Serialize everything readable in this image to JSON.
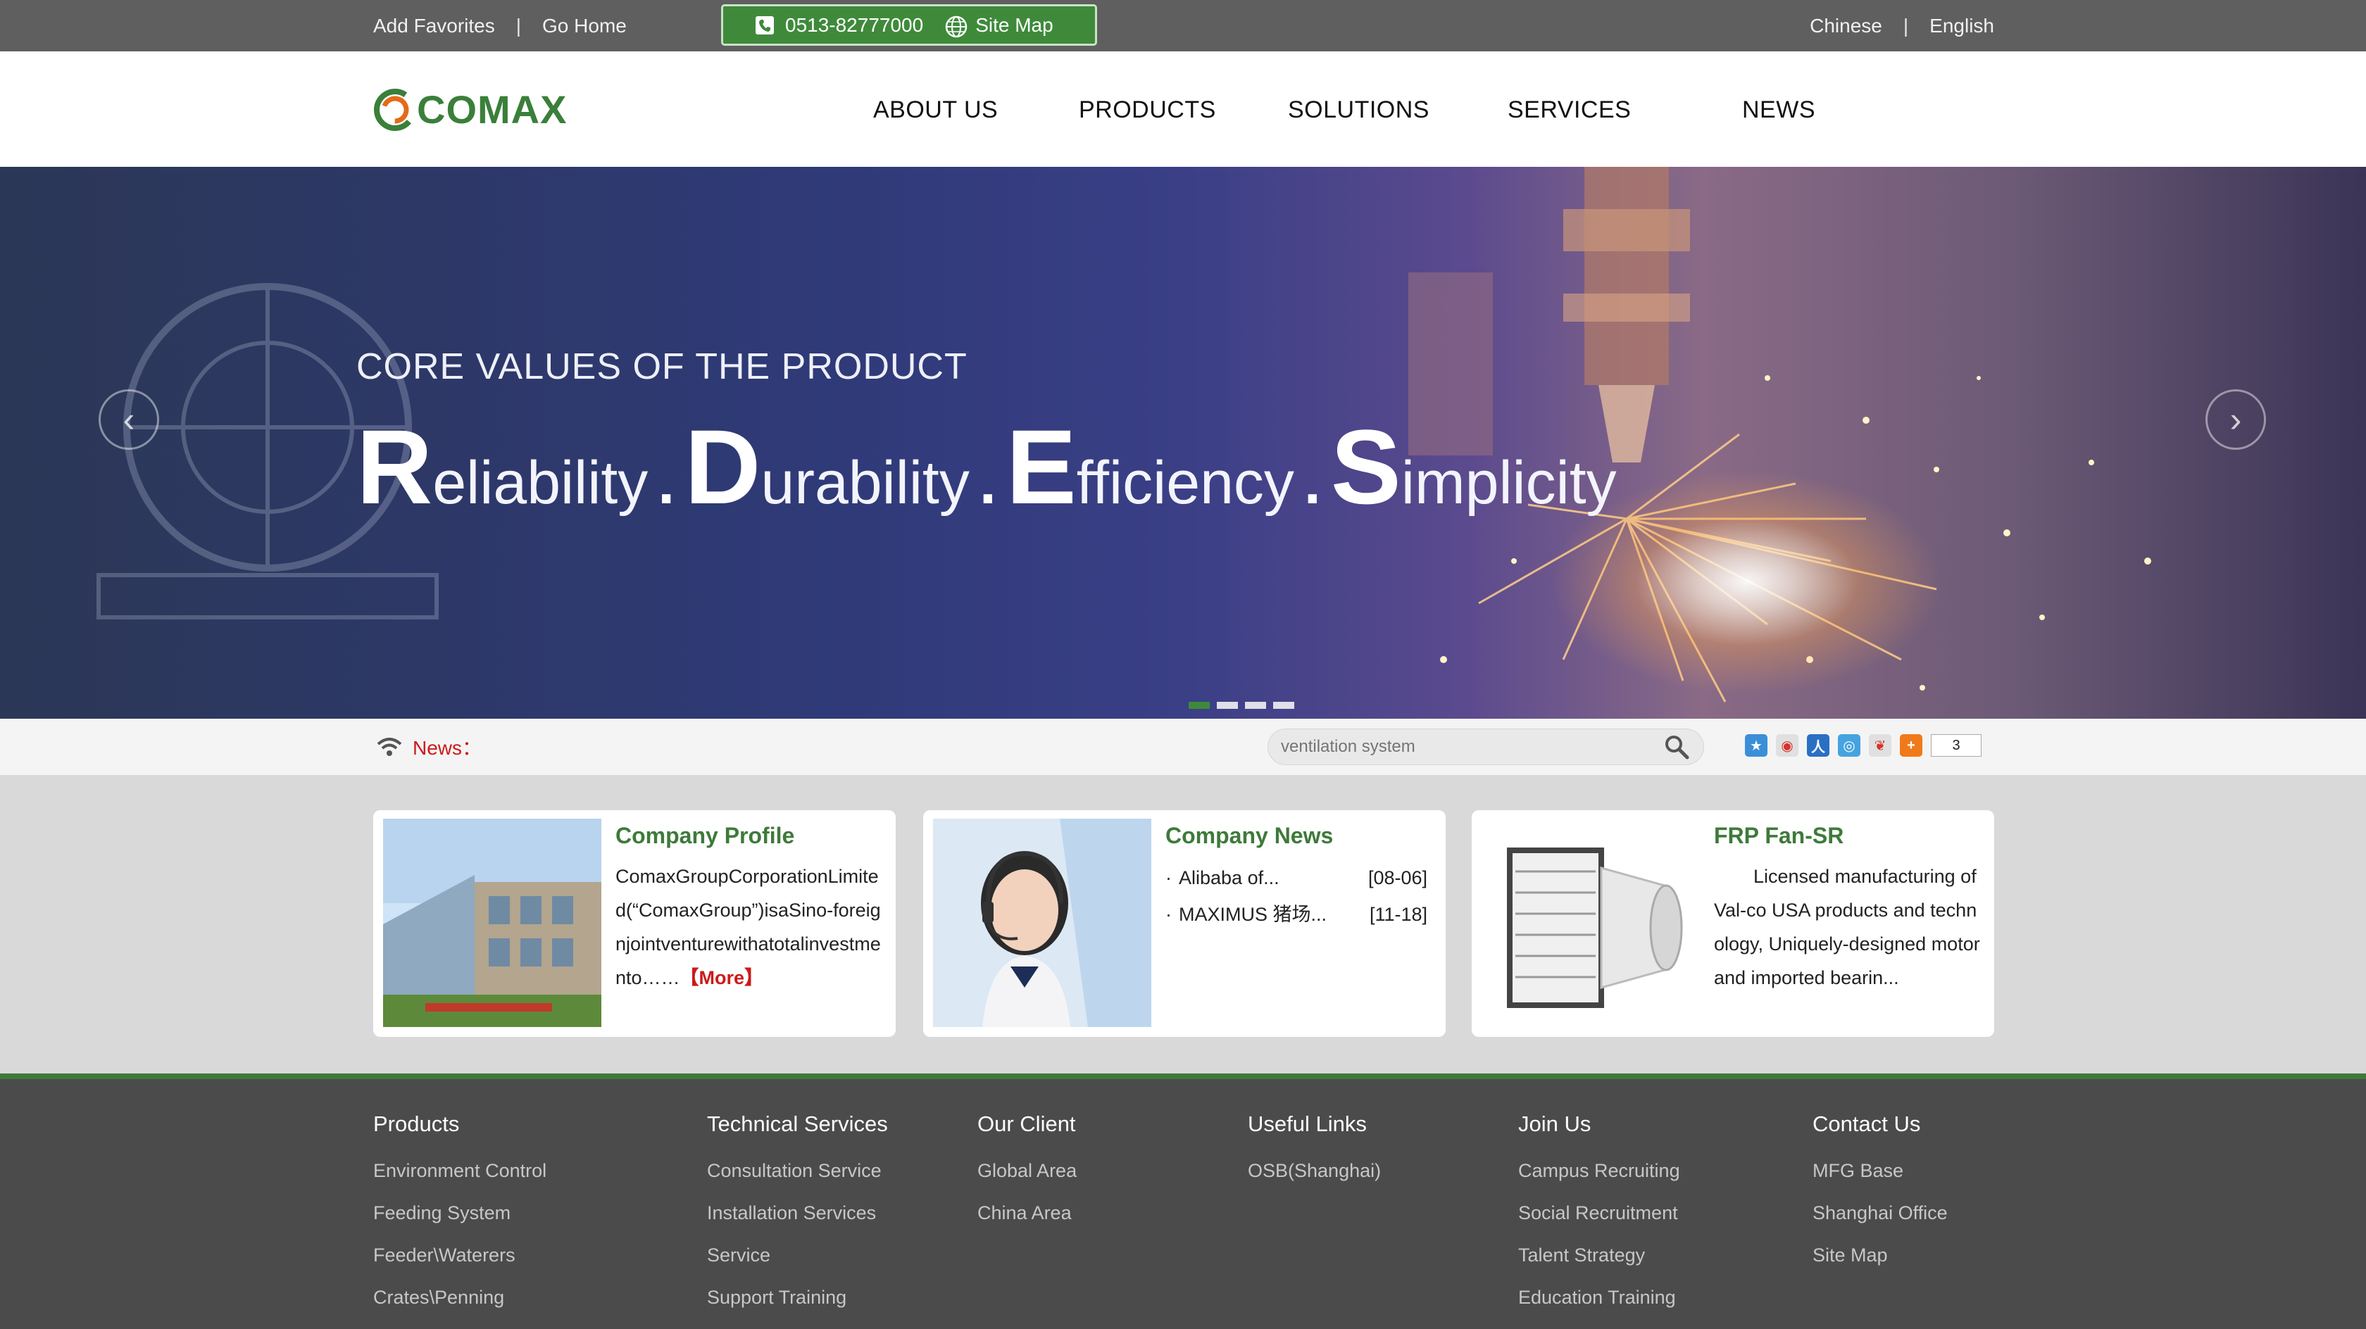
{
  "topbar": {
    "add_favorites": "Add Favorites",
    "separator": "|",
    "go_home": "Go Home",
    "phone": "0513-82777000",
    "site_map": "Site Map",
    "chinese": "Chinese",
    "english": "English"
  },
  "header": {
    "logo_text": "COMAX",
    "nav": [
      "ABOUT US",
      "PRODUCTS",
      "SOLUTIONS",
      "SERVICES",
      "NEWS"
    ]
  },
  "hero": {
    "subtitle": "CORE VALUES OF THE PRODUCT",
    "words": [
      {
        "initial": "R",
        "rest": "eliability"
      },
      {
        "initial": "D",
        "rest": "urability"
      },
      {
        "initial": "E",
        "rest": "fficiency"
      },
      {
        "initial": "S",
        "rest": "implicity"
      }
    ],
    "dot": ".",
    "prev_arrow": "‹",
    "next_arrow": "›",
    "slides_total": 4,
    "slide_active": 1
  },
  "newsbar": {
    "label": "News：",
    "search_placeholder": "ventilation system",
    "share_count": "3",
    "share_icons": [
      "qzone-icon",
      "weibo-icon",
      "renren-icon",
      "tencent-weibo-icon",
      "share-icon",
      "more-share-icon"
    ]
  },
  "cards": {
    "profile": {
      "title": "Company Profile",
      "body": "ComaxGroupCorporationLimited(“ComaxGroup”)isaSino-foreignjointventurewithatotalinvestmento……",
      "more": "【More】"
    },
    "news": {
      "title": "Company News",
      "items": [
        {
          "text": "Alibaba of...",
          "date": "[08-06]"
        },
        {
          "text": "MAXIMUS 猪场...",
          "date": "[11-18]"
        }
      ],
      "bullet": "·"
    },
    "product": {
      "title": "FRP Fan-SR",
      "body": "Licensed manufacturing of Val-co USA products and technology, Uniquely-designed motor and imported bearin..."
    }
  },
  "footer": {
    "columns": [
      {
        "title": "Products",
        "links": [
          "Environment Control",
          "Feeding System",
          "Feeder\\Waterers",
          "Crates\\Penning"
        ]
      },
      {
        "title": "Technical Services",
        "links": [
          "Consultation Service",
          "Installation Services",
          "Service",
          "Support Training"
        ]
      },
      {
        "title": "Our Client",
        "links": [
          "Global Area",
          "China Area"
        ]
      },
      {
        "title": "Useful Links",
        "links": [
          "OSB(Shanghai)"
        ]
      },
      {
        "title": "Join Us",
        "links": [
          "Campus Recruiting",
          "Social Recruitment",
          "Talent Strategy",
          "Education Training"
        ]
      },
      {
        "title": "Contact Us",
        "links": [
          "MFG Base",
          "Shanghai Office",
          "Site Map"
        ]
      }
    ]
  },
  "colors": {
    "brand_green": "#3e8a3a",
    "news_red": "#cc1a1a",
    "topbar_gray": "#5f5f5f",
    "footer_gray": "#4b4b4b"
  }
}
